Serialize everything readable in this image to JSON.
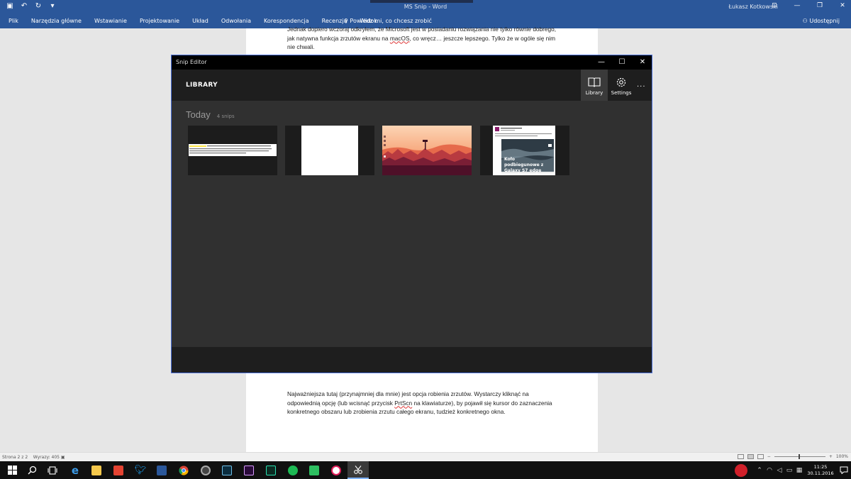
{
  "word": {
    "window_title": "MS Snip  -  Word",
    "user_name": "Łukasz Kotkowski",
    "ribbon_tabs": [
      "Plik",
      "Narzędzia główne",
      "Wstawianie",
      "Projektowanie",
      "Układ",
      "Odwołania",
      "Korespondencja",
      "Recenzja",
      "Widok"
    ],
    "tell_me": "Powiedz mi, co chcesz zrobić",
    "share_label": "Udostępnij",
    "status_page": "Strona 2 z 2",
    "status_words": "Wyrazy: 405",
    "zoom_label": "100%"
  },
  "doc": {
    "para_top": {
      "t1": "Jednak dopiero wczoraj odkryłem, że Microsoft jest w posiadaniu rozwiązania nie tylko równie dobrego, jak natywna funkcja zrzutów ekranu na ",
      "macos": "macOS",
      "t2": ", co wręcz… jeszcze lepszego. Tylko że w ogóle się nim nie chwali."
    },
    "para_bottom": {
      "t1": "Najważniejsza tutaj (przynajmniej dla mnie) jest opcja robienia zrzutów. Wystarczy kliknąć na odpowiednią opcję (lub wcisnąć przycisk ",
      "prtscn": "PrtScn",
      "t2": " na klawiaturze), by pojawił się kursor do zaznaczenia konkretnego obszaru lub zrobienia zrzutu całego ekranu, tudzież konkretnego okna."
    }
  },
  "snip_editor": {
    "title": "Snip Editor",
    "heading": "LIBRARY",
    "library_label": "Library",
    "settings_label": "Settings",
    "more_label": "...",
    "section_title": "Today",
    "snip_count": "4 snips",
    "thumb4_caption": "Koło podbiegunowe z Galaxy S7 edge"
  },
  "taskbar": {
    "time": "11:25",
    "date": "30.11.2016"
  },
  "colors": {
    "word_blue": "#2b579a",
    "snip_bg": "#303030",
    "snip_header": "#1e1e1e",
    "accent_border": "#4a6fd8"
  }
}
